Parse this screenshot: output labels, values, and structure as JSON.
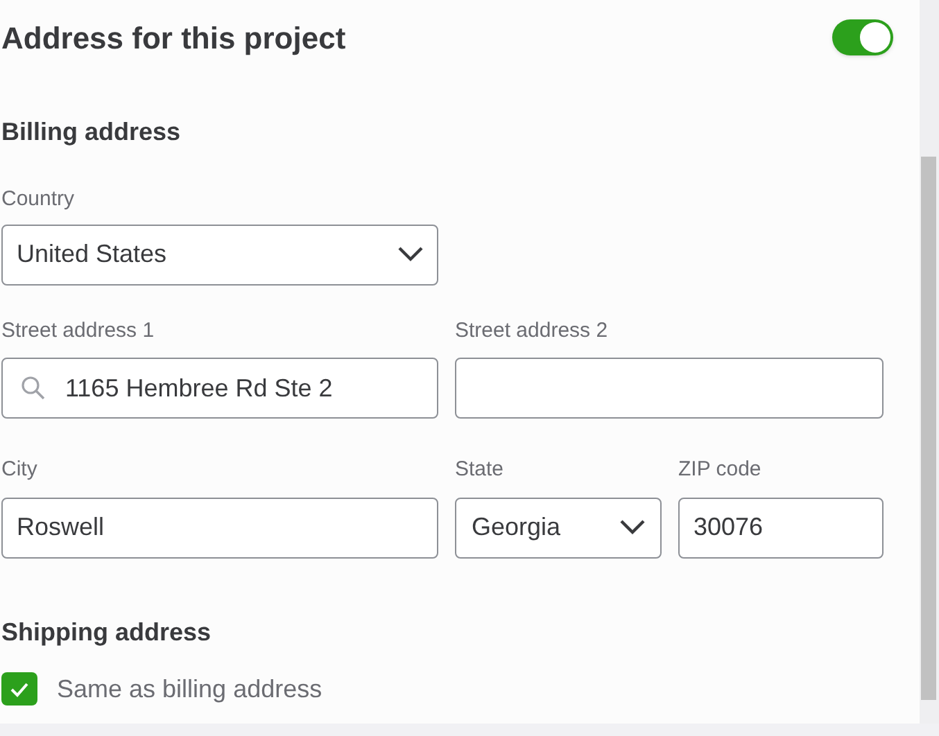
{
  "title": "Address for this project",
  "address_toggle": {
    "on": true
  },
  "billing": {
    "heading": "Billing address",
    "country": {
      "label": "Country",
      "value": "United States"
    },
    "street_1": {
      "label": "Street address 1",
      "value": "1165 Hembree Rd Ste 2"
    },
    "street_2": {
      "label": "Street address 2"
    },
    "city": {
      "label": "City",
      "value": "Roswell"
    },
    "state": {
      "label": "State",
      "value": "Georgia"
    },
    "zip": {
      "label": "ZIP code",
      "value": "30076"
    }
  },
  "shipping": {
    "heading": "Shipping address",
    "same_as_billing": {
      "label": "Same as billing address",
      "checked": true
    }
  }
}
